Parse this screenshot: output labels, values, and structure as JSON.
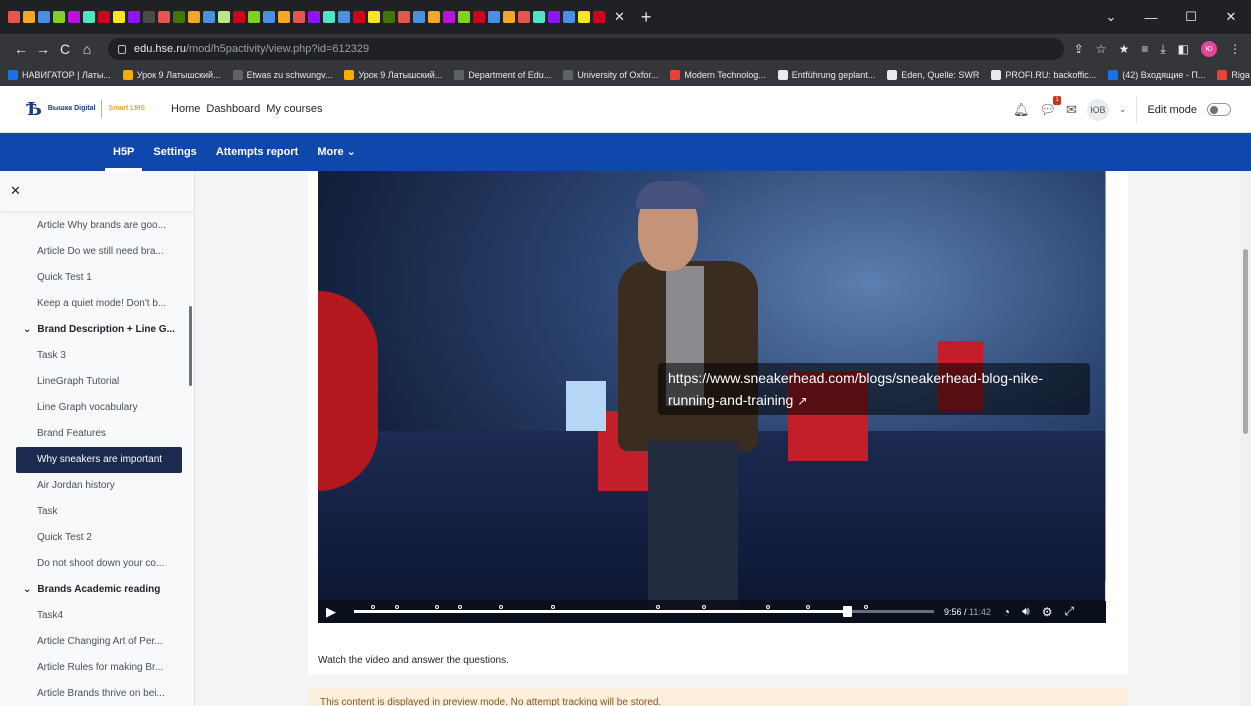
{
  "browser": {
    "tab_favicon_colors": [
      "#e8554e",
      "#f5a623",
      "#4a90e2",
      "#7ed321",
      "#bd10e0",
      "#50e3c2",
      "#d0021b",
      "#f8e71c",
      "#9013fe",
      "#4a4a4a",
      "#e8554e",
      "#417505",
      "#f5a623",
      "#4a90e2",
      "#b8e986",
      "#d0021b",
      "#7ed321",
      "#4a90e2",
      "#f5a623",
      "#e8554e",
      "#9013fe",
      "#50e3c2",
      "#4a90e2",
      "#d0021b",
      "#f8e71c",
      "#417505",
      "#e8554e",
      "#4a90e2",
      "#f5a623",
      "#bd10e0",
      "#7ed321",
      "#d0021b",
      "#4a90e2",
      "#f5a623",
      "#e8554e",
      "#50e3c2",
      "#9013fe",
      "#4a90e2",
      "#f8e71c",
      "#d0021b"
    ],
    "url_host": "edu.hse.ru",
    "url_path": "/mod/h5pactivity/view.php?id=612329",
    "profile_initials": "Ю",
    "bookmarks": [
      {
        "label": "НАВИГАТОР | Латы...",
        "color": "#1a73e8"
      },
      {
        "label": "Урок 9 Латышский...",
        "color": "#f9ab00"
      },
      {
        "label": "Etwas zu schwungv...",
        "color": "#5f6368"
      },
      {
        "label": "Урок 9 Латышский...",
        "color": "#f9ab00"
      },
      {
        "label": "Department of Edu...",
        "color": "#5f6368"
      },
      {
        "label": "University of Oxfor...",
        "color": "#5f6368"
      },
      {
        "label": "Modern Technolog...",
        "color": "#ea4335"
      },
      {
        "label": "Entführung geplant...",
        "color": "#e8eaed"
      },
      {
        "label": "Eden, Quelle: SWR",
        "color": "#e8eaed"
      },
      {
        "label": "PROFI.RU: backoffic...",
        "color": "#e8eaed"
      },
      {
        "label": "(42) Входящие - П...",
        "color": "#1a73e8"
      },
      {
        "label": "Riga TV24 онлайн...",
        "color": "#ea4335"
      }
    ]
  },
  "site": {
    "logo_text": "Вышка Digital",
    "logo_sub": "Smart LMS",
    "nav": [
      "Home",
      "Dashboard",
      "My courses"
    ],
    "notification_count": "1",
    "user_initials": "ЮВ",
    "edit_mode_label": "Edit mode"
  },
  "secondary_nav": [
    {
      "label": "H5P",
      "active": true
    },
    {
      "label": "Settings",
      "active": false
    },
    {
      "label": "Attempts report",
      "active": false
    },
    {
      "label": "More ⌄",
      "active": false
    }
  ],
  "course_index": [
    {
      "type": "item",
      "label": "Article Why brands are goo..."
    },
    {
      "type": "item",
      "label": "Article Do we still need bra..."
    },
    {
      "type": "item",
      "label": "Quick Test 1"
    },
    {
      "type": "item",
      "label": "Keep a quiet mode! Don't b..."
    },
    {
      "type": "section",
      "label": "Brand Description + Line G..."
    },
    {
      "type": "item",
      "label": "Task 3"
    },
    {
      "type": "item",
      "label": "LineGraph Tutorial"
    },
    {
      "type": "item",
      "label": "Line Graph vocabulary"
    },
    {
      "type": "item",
      "label": "Brand Features"
    },
    {
      "type": "active",
      "label": "Why sneakers are important"
    },
    {
      "type": "item",
      "label": "Air Jordan history"
    },
    {
      "type": "item",
      "label": "Task"
    },
    {
      "type": "item",
      "label": "Quick Test 2"
    },
    {
      "type": "item",
      "label": "Do not shoot down your co..."
    },
    {
      "type": "section",
      "label": "Brands Academic reading"
    },
    {
      "type": "item",
      "label": "Task4"
    },
    {
      "type": "item",
      "label": "Article Changing Art of Per..."
    },
    {
      "type": "item",
      "label": "Article Rules for making Br..."
    },
    {
      "type": "item",
      "label": "Article Brands thrive on bei..."
    }
  ],
  "video": {
    "link_text": "https://www.sneakerhead.com/blogs/sneakerhead-blog-nike-running-and-training",
    "current_time": "9:56",
    "total_time": "11:42",
    "progress_fraction": 0.85,
    "marker_fractions": [
      0.03,
      0.07,
      0.14,
      0.18,
      0.25,
      0.34,
      0.52,
      0.6,
      0.71,
      0.78,
      0.88
    ]
  },
  "instruction": "Watch the video and answer the questions.",
  "preview_notice": "This content is displayed in preview mode. No attempt tracking will be stored."
}
